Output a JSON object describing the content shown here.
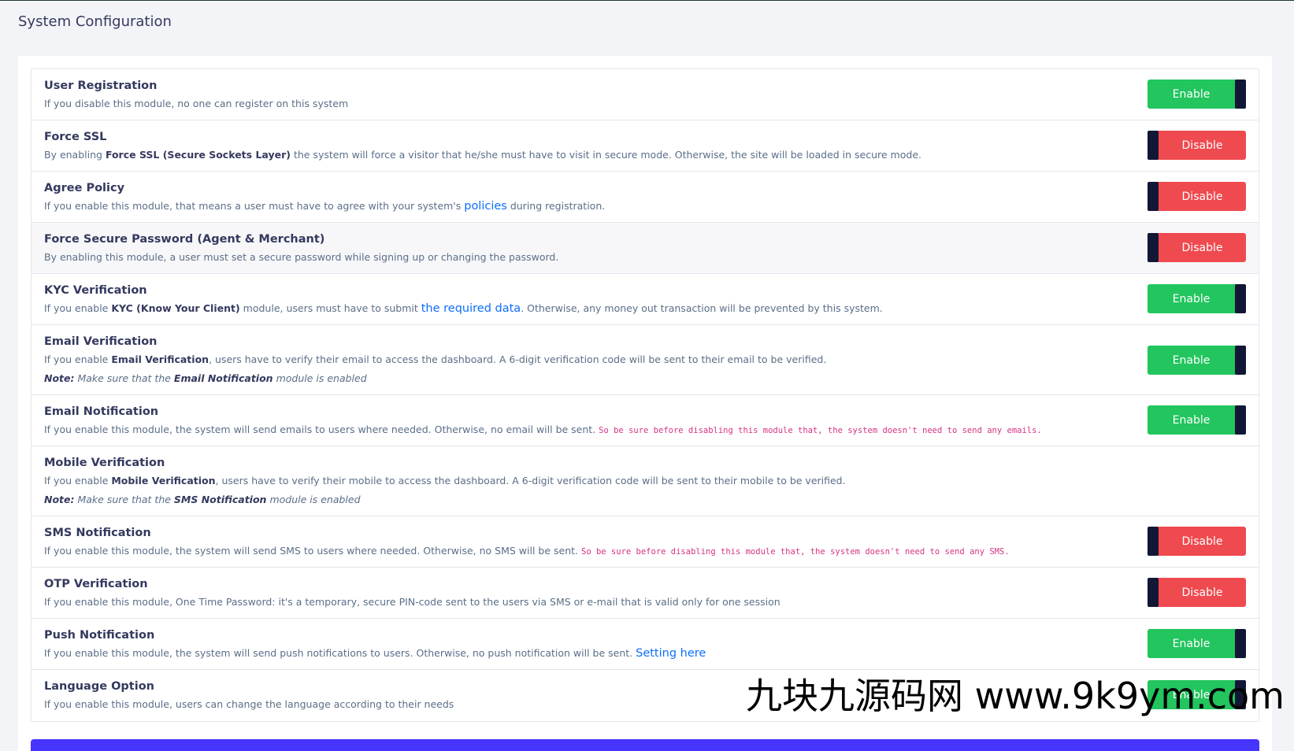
{
  "page": {
    "title": "System Configuration"
  },
  "modules": [
    {
      "title": "User Registration",
      "desc": "If you disable this module, no one can register on this system",
      "state": "Enable"
    },
    {
      "title": "Force SSL",
      "desc_pre": "By enabling ",
      "desc_bold": "Force SSL (Secure Sockets Layer)",
      "desc_post": " the system will force a visitor that he/she must have to visit in secure mode. Otherwise, the site will be loaded in secure mode.",
      "state": "Disable"
    },
    {
      "title": "Agree Policy",
      "desc_pre": "If you enable this module, that means a user must have to agree with your system's ",
      "link": "policies",
      "desc_post": " during registration.",
      "state": "Disable"
    },
    {
      "title": "Force Secure Password (Agent & Merchant)",
      "desc": "By enabling this module, a user must set a secure password while signing up or changing the password.",
      "state": "Disable"
    },
    {
      "title": "KYC Verification",
      "desc_pre": "If you enable ",
      "desc_bold": "KYC (Know Your Client)",
      "desc_mid": " module, users must have to submit ",
      "link": "the required data",
      "desc_post": ". Otherwise, any money out transaction will be prevented by this system.",
      "state": "Enable"
    },
    {
      "title": "Email Verification",
      "desc_pre": "If you enable ",
      "desc_bold": "Email Verification",
      "desc_post": ", users have to verify their email to access the dashboard. A 6-digit verification code will be sent to their email to be verified.",
      "note_label": "Note:",
      "note_pre": " Make sure that the ",
      "note_bold": "Email Notification",
      "note_post": " module is enabled",
      "state": "Enable"
    },
    {
      "title": "Email Notification",
      "desc": "If you enable this module, the system will send emails to users where needed. Otherwise, no email will be sent. ",
      "code": "So be sure before disabling this module that, the system doesn't need to send any emails.",
      "state": "Enable"
    },
    {
      "title": "Mobile Verification",
      "desc_pre": "If you enable ",
      "desc_bold": "Mobile Verification",
      "desc_post": ", users have to verify their mobile to access the dashboard. A 6-digit verification code will be sent to their mobile to be verified.",
      "note_label": "Note:",
      "note_pre": " Make sure that the ",
      "note_bold": "SMS Notification",
      "note_post": " module is enabled"
    },
    {
      "title": "SMS Notification",
      "desc": "If you enable this module, the system will send SMS to users where needed. Otherwise, no SMS will be sent. ",
      "code": "So be sure before disabling this module that, the system doesn't need to send any SMS.",
      "state": "Disable"
    },
    {
      "title": "OTP Verification",
      "desc": "If you enable this module, One Time Password: it's a temporary, secure PIN-code sent to the users via SMS or e-mail that is valid only for one session",
      "state": "Disable"
    },
    {
      "title": "Push Notification",
      "desc": "If you enable this module, the system will send push notifications to users. Otherwise, no push notification will be sent. ",
      "link": "Setting here",
      "state": "Enable"
    },
    {
      "title": "Language Option",
      "desc": "If you enable this module, users can change the language according to their needs",
      "state": "Enable"
    }
  ],
  "watermark": "九块九源码网 www.9k9ym.com",
  "colors": {
    "enable": "#22c55e",
    "disable": "#ef4a4f",
    "knob": "#111735",
    "primary": "#4634ff",
    "link": "#0d6efd"
  }
}
